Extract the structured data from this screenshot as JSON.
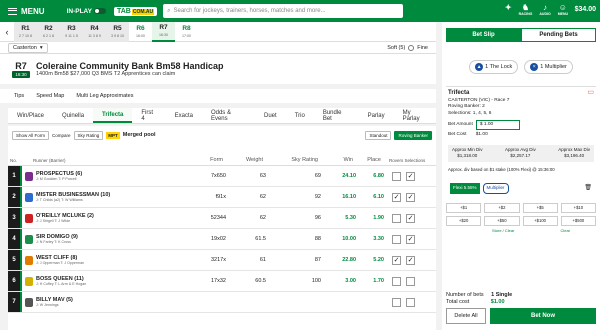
{
  "header": {
    "menu": "MENU",
    "inplay": "IN-PLAY",
    "logo": "TAB",
    "logo_tag": "COM.AU",
    "search_placeholder": "Search for jockeys, trainers, horses, matches and more...",
    "icons": [
      {
        "icon": "gift-icon",
        "label": ""
      },
      {
        "icon": "horse-icon",
        "label": "RACING"
      },
      {
        "icon": "audio-icon",
        "label": "AUDIO"
      },
      {
        "icon": "user-icon",
        "label": "MENU"
      }
    ],
    "balance": "$34.00"
  },
  "races": [
    {
      "n": "R1",
      "r": "2 7 10 8",
      "s": "done"
    },
    {
      "n": "R2",
      "r": "6 2 1 8",
      "s": "done"
    },
    {
      "n": "R3",
      "r": "9 11 1 5",
      "s": "done"
    },
    {
      "n": "R4",
      "r": "11 3 8 9",
      "s": "done"
    },
    {
      "n": "R5",
      "r": "3 9 8 10",
      "s": "done"
    },
    {
      "n": "R6",
      "r": "16:00",
      "s": "up"
    },
    {
      "n": "R7",
      "r": "16:30",
      "s": "sel"
    },
    {
      "n": "R8",
      "r": "17:00",
      "s": "up"
    }
  ],
  "venue": {
    "select": "Casterton",
    "track": "Soft (5)",
    "rail": "Fine"
  },
  "race": {
    "num": "R7",
    "time": "16:30",
    "title": "Coleraine Community Bank Bm58 Handicap",
    "meta": "1400m  Bm58  $27,000  Q3  BMS  T2  Apprentices can claim"
  },
  "nav": [
    "Tips",
    "Speed Map",
    "Multi Leg Approximates"
  ],
  "bet_tabs": [
    "Win/Place",
    "Quinella",
    "Trifecta",
    "First 4",
    "Exacta",
    "Odds & Evens",
    "Duet",
    "Trio",
    "Bundle Bet",
    "Parlay",
    "My Parlay"
  ],
  "toolbar": {
    "show_form": "Show All Form",
    "compare": "Compare",
    "rating": "Sky Rating",
    "mpt": "MPT",
    "merged": "Merged pool",
    "standout": "Standout",
    "roving": "Roving Banker"
  },
  "cols": {
    "no": "No.",
    "runner": "Runner (Barrier)",
    "form": "Form",
    "weight": "Weight",
    "sky": "Sky Rating",
    "win": "Win",
    "place": "Place",
    "rovers": "Rovers Selections"
  },
  "runners": [
    {
      "no": "1",
      "name": "PROSPECTUS (6)",
      "sub": "J: M Goolden   T: P Purcell",
      "form": "7x650",
      "w": "63",
      "sky": "69",
      "win": "24.10",
      "pl": "6.80",
      "c1": "",
      "c2": "✓",
      "color": "#7b2d8e"
    },
    {
      "no": "2",
      "name": "MISTER BUSINESSMAN (10)",
      "sub": "J: T Childs (a2)   T: W Williams",
      "form": "f91x",
      "w": "62",
      "sky": "92",
      "win": "16.10",
      "pl": "6.10",
      "c1": "✓",
      "c2": "✓",
      "color": "#2e6bd1"
    },
    {
      "no": "3",
      "name": "O'REILLY MCLUKE (2)",
      "sub": "J: J Stirgell   T: J Wilde",
      "form": "52344",
      "w": "62",
      "sky": "96",
      "win": "5.30",
      "pl": "1.90",
      "c1": "",
      "c2": "✓",
      "color": "#cc2222"
    },
    {
      "no": "4",
      "name": "SIR DOMIGO (9)",
      "sub": "J: N Farley   T: K Cross",
      "form": "19x02",
      "w": "61.5",
      "sky": "88",
      "win": "10.00",
      "pl": "3.30",
      "c1": "",
      "c2": "✓",
      "color": "#1a8f4a"
    },
    {
      "no": "5",
      "name": "WEST CLIFF (8)",
      "sub": "J: J Opperman   T: J Opperman",
      "form": "3217x",
      "w": "61",
      "sky": "87",
      "win": "22.80",
      "pl": "5.20",
      "c1": "✓",
      "c2": "✓",
      "color": "#e07b00"
    },
    {
      "no": "6",
      "name": "BOSS QUEEN (11)",
      "sub": "J: H Coffey   T: L Arrn & E Hogan",
      "form": "17x32",
      "w": "60.5",
      "sky": "100",
      "win": "3.00",
      "pl": "1.70",
      "c1": "",
      "c2": "",
      "color": "#d4b000"
    },
    {
      "no": "7",
      "name": "BILLY MAV (5)",
      "sub": "J: W Jennings",
      "form": "",
      "w": "",
      "sky": "",
      "win": "",
      "pl": "",
      "c1": "",
      "c2": "",
      "color": "#555"
    }
  ],
  "slip": {
    "tab1": "Bet Slip",
    "tab2": "Pending Bets",
    "lock": "1 The Lock",
    "multi": "1 Multiplier",
    "type": "Trifecta",
    "venue": "CASTERTON (VIC) - Race 7",
    "roving": "Roving Banker: 2",
    "sels": "Selections: 1, 4, 5, 6",
    "amount_label": "Bet Amount",
    "amount": "$ 1.00",
    "cost_label": "Bet Cost",
    "cost": "$1.00",
    "approx": [
      {
        "l": "Approx Min Div",
        "v": "$1,318.00"
      },
      {
        "l": "Approx Avg Div",
        "v": "$2,257.17"
      },
      {
        "l": "Approx Max Div",
        "v": "$3,196.40"
      }
    ],
    "note": "Approx. div based on $1 stake (100% Flexi) @ 15:36:00",
    "flexi": "Flexi 5.55%",
    "multiplier": "Multiplier",
    "quick": [
      "+$1",
      "+$2",
      "+$5",
      "+$10",
      "+$20",
      "+$50",
      "+$100",
      "+$500"
    ],
    "store": "Store / Clear",
    "clear": "Clear",
    "nbets_label": "Number of bets",
    "nbets": "1 Single",
    "total_label": "Total cost",
    "total": "$1.00",
    "delete": "Delete All",
    "betnow": "Bet Now"
  }
}
